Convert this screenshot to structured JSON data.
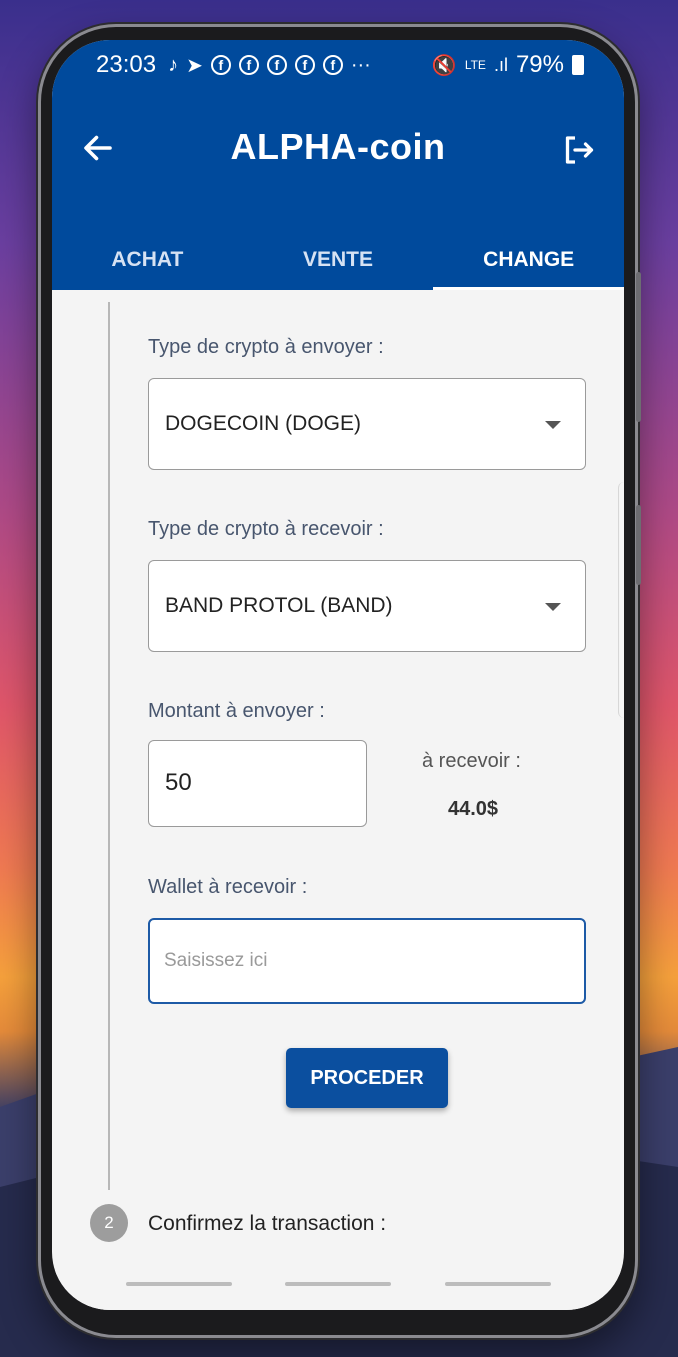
{
  "status_bar": {
    "time": "23:03",
    "network": "LTE",
    "battery": "79%"
  },
  "app_bar": {
    "title": "ALPHA-coin"
  },
  "tabs": [
    {
      "label": "ACHAT",
      "active": false
    },
    {
      "label": "VENTE",
      "active": false
    },
    {
      "label": "CHANGE",
      "active": true
    }
  ],
  "form": {
    "send_type_label": "Type de crypto à envoyer :",
    "send_type_value": "DOGECOIN (DOGE)",
    "receive_type_label": "Type de crypto à recevoir :",
    "receive_type_value": "BAND PROTOL (BAND)",
    "amount_label": "Montant à envoyer :",
    "amount_value": "50",
    "receive_amount_label": "à recevoir :",
    "receive_amount_value": "44.0$",
    "wallet_label": "Wallet à recevoir :",
    "wallet_placeholder": "Saisissez ici",
    "submit_label": "PROCEDER"
  },
  "step2": {
    "number": "2",
    "label": "Confirmez la transaction :"
  },
  "colors": {
    "primary": "#004a9c",
    "button": "#0b4f9f",
    "background": "#f4f4f4"
  }
}
